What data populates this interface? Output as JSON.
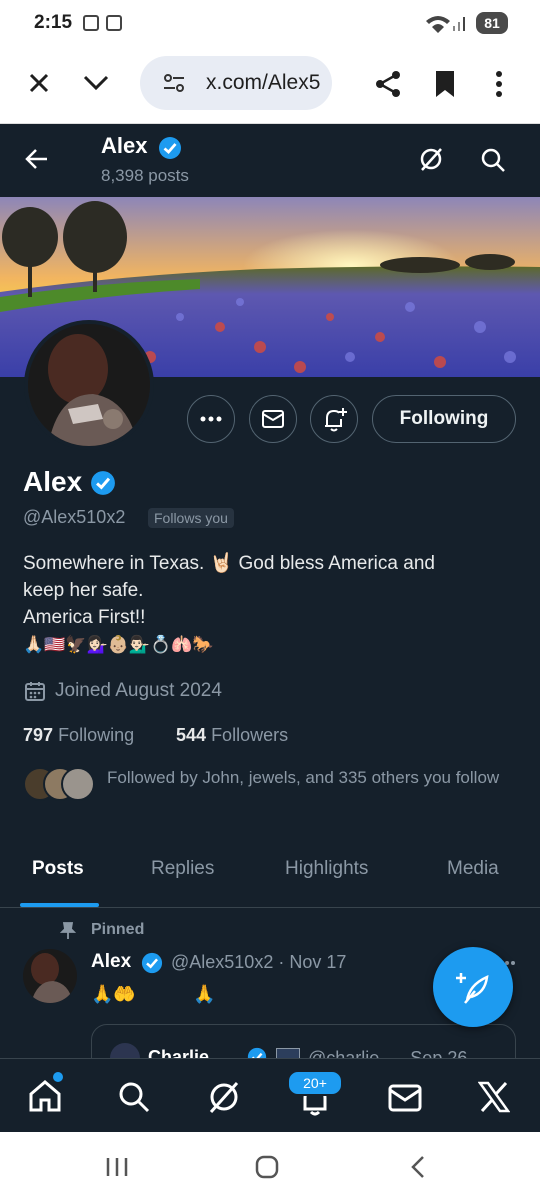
{
  "status_bar": {
    "time": "2:15",
    "battery": "81"
  },
  "browser": {
    "url": "x.com/Alex5"
  },
  "header": {
    "name": "Alex",
    "posts": "8,398 posts"
  },
  "profile": {
    "name": "Alex",
    "handle": "@Alex510x2",
    "follows_you": "Follows you",
    "follow_button": "Following",
    "bio_line1": "Somewhere in Texas. 🤘🏻 God bless America and",
    "bio_line2": "keep her safe.",
    "bio_line3": "America First!!",
    "bio_emojis": "🙏🏻🇺🇸🦅💁🏻‍♀️👶🏼💁🏻‍♂️💍🫁🐎",
    "joined": "Joined August 2024",
    "following_count": "797",
    "following_label": "Following",
    "followers_count": "544",
    "followers_label": "Followers",
    "followed_by": "Followed by John, jewels, and 335 others you follow"
  },
  "tabs": [
    {
      "label": "Posts"
    },
    {
      "label": "Replies"
    },
    {
      "label": "Highlights"
    },
    {
      "label": "Media"
    }
  ],
  "tweet": {
    "pinned": "Pinned",
    "name": "Alex",
    "meta": "@Alex510x2 · Nov 17",
    "text": "🙏🤲          🙏",
    "quote_name": "Charlie",
    "quote_meta": "@charlie... · Sep 26"
  },
  "bottom_nav": {
    "notif_badge": "20+"
  },
  "colors": {
    "accent": "#1d9bf0",
    "background": "#15202b",
    "muted": "#8b98a5"
  }
}
